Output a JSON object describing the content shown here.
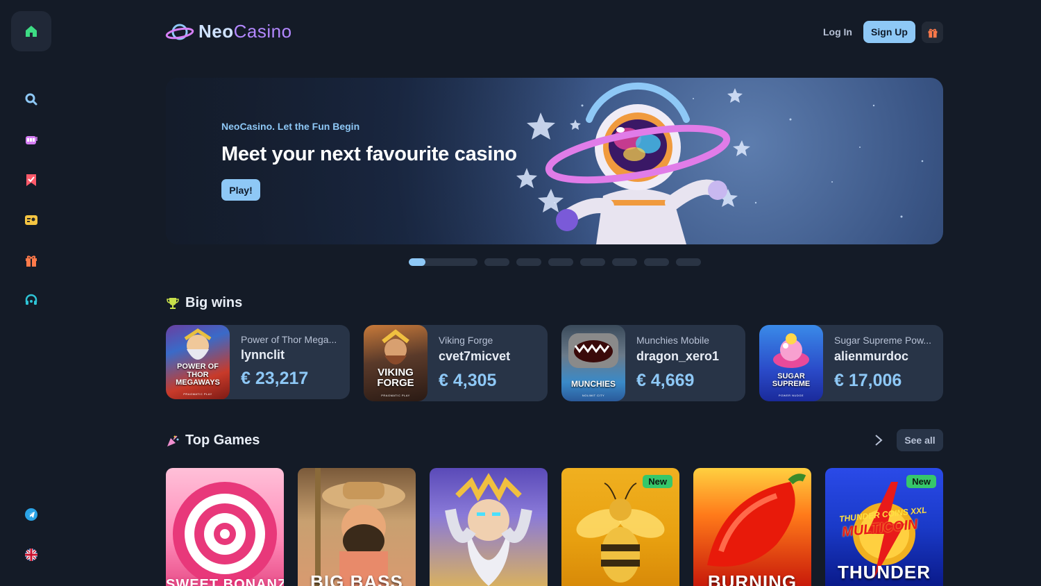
{
  "header": {
    "logo_neo": "Neo",
    "logo_casino": "Casino",
    "login_label": "Log In",
    "signup_label": "Sign Up"
  },
  "sidebar": {
    "items": [
      {
        "name": "home-icon",
        "color": "#3ddc84"
      },
      {
        "name": "search-icon",
        "color": "#8ec8f6"
      },
      {
        "name": "slots-icon",
        "color": "#d67ff5"
      },
      {
        "name": "bookmark-icon",
        "color": "#ff5a6a"
      },
      {
        "name": "profile-card-icon",
        "color": "#f5c542"
      },
      {
        "name": "gift-icon",
        "color": "#ff7a4a"
      },
      {
        "name": "support-icon",
        "color": "#2ec4d6"
      },
      {
        "name": "telegram-icon",
        "color": "#2aa3e6"
      },
      {
        "name": "uk-flag-icon",
        "color": "#c8102e"
      }
    ]
  },
  "hero": {
    "subtitle": "NeoCasino. Let the Fun Begin",
    "title": "Meet your next favourite casino",
    "button_label": "Play!",
    "slides_total": 8,
    "active_slide": 1
  },
  "big_wins": {
    "title": "Big wins",
    "cards": [
      {
        "game": "Power of Thor Mega...",
        "user": "lynnclit",
        "amount": "€ 23,217",
        "thumb_label": "POWER OF THOR MEGAWAYS",
        "thumb_sub": "PRAGMATIC PLAY"
      },
      {
        "game": "Viking Forge",
        "user": "cvet7micvet",
        "amount": "€ 4,305",
        "thumb_label": "VIKING FORGE",
        "thumb_sub": "PRAGMATIC PLAY"
      },
      {
        "game": "Munchies Mobile",
        "user": "dragon_xero1",
        "amount": "€ 4,669",
        "thumb_label": "MUNCHIES",
        "thumb_sub": "NOLIMIT CITY"
      },
      {
        "game": "Sugar Supreme Pow...",
        "user": "alienmurdoc",
        "amount": "€ 17,006",
        "thumb_label": "SUGAR SUPREME",
        "thumb_sub": "POWER NUDGE"
      }
    ]
  },
  "top_games": {
    "title": "Top Games",
    "see_all_label": "See all",
    "games": [
      {
        "name": "SWEET BONANZA",
        "badge": ""
      },
      {
        "name": "BIG BASS",
        "badge": ""
      },
      {
        "name": "",
        "badge": ""
      },
      {
        "name": "",
        "badge": "New"
      },
      {
        "name": "BURNING",
        "badge": ""
      },
      {
        "name": "THUNDER",
        "badge": "New",
        "sub": "THUNDER COINS XXL",
        "sub2": "MULTICOIN"
      }
    ]
  }
}
